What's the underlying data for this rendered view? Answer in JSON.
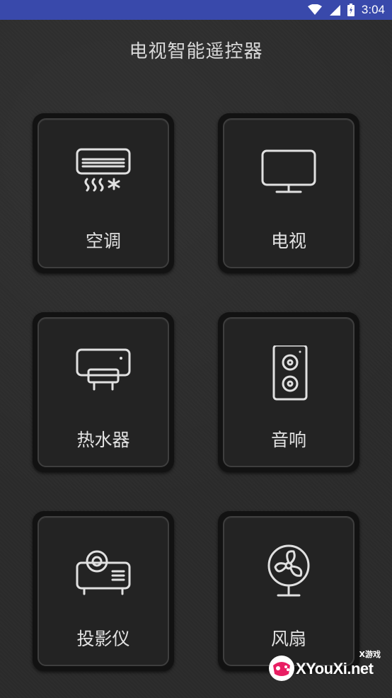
{
  "status_bar": {
    "time": "3:04",
    "icons": [
      "wifi-icon",
      "signal-icon",
      "battery-icon"
    ],
    "background": "#3949ab"
  },
  "header": {
    "title": "电视智能遥控器"
  },
  "devices": [
    {
      "label": "空调",
      "icon": "air-conditioner-icon"
    },
    {
      "label": "电视",
      "icon": "tv-icon"
    },
    {
      "label": "热水器",
      "icon": "water-heater-icon"
    },
    {
      "label": "音响",
      "icon": "speaker-icon"
    },
    {
      "label": "投影仪",
      "icon": "projector-icon"
    },
    {
      "label": "风扇",
      "icon": "fan-icon"
    }
  ],
  "watermark": {
    "small_text": "X游戏",
    "main_text": "XYouXi.net"
  }
}
